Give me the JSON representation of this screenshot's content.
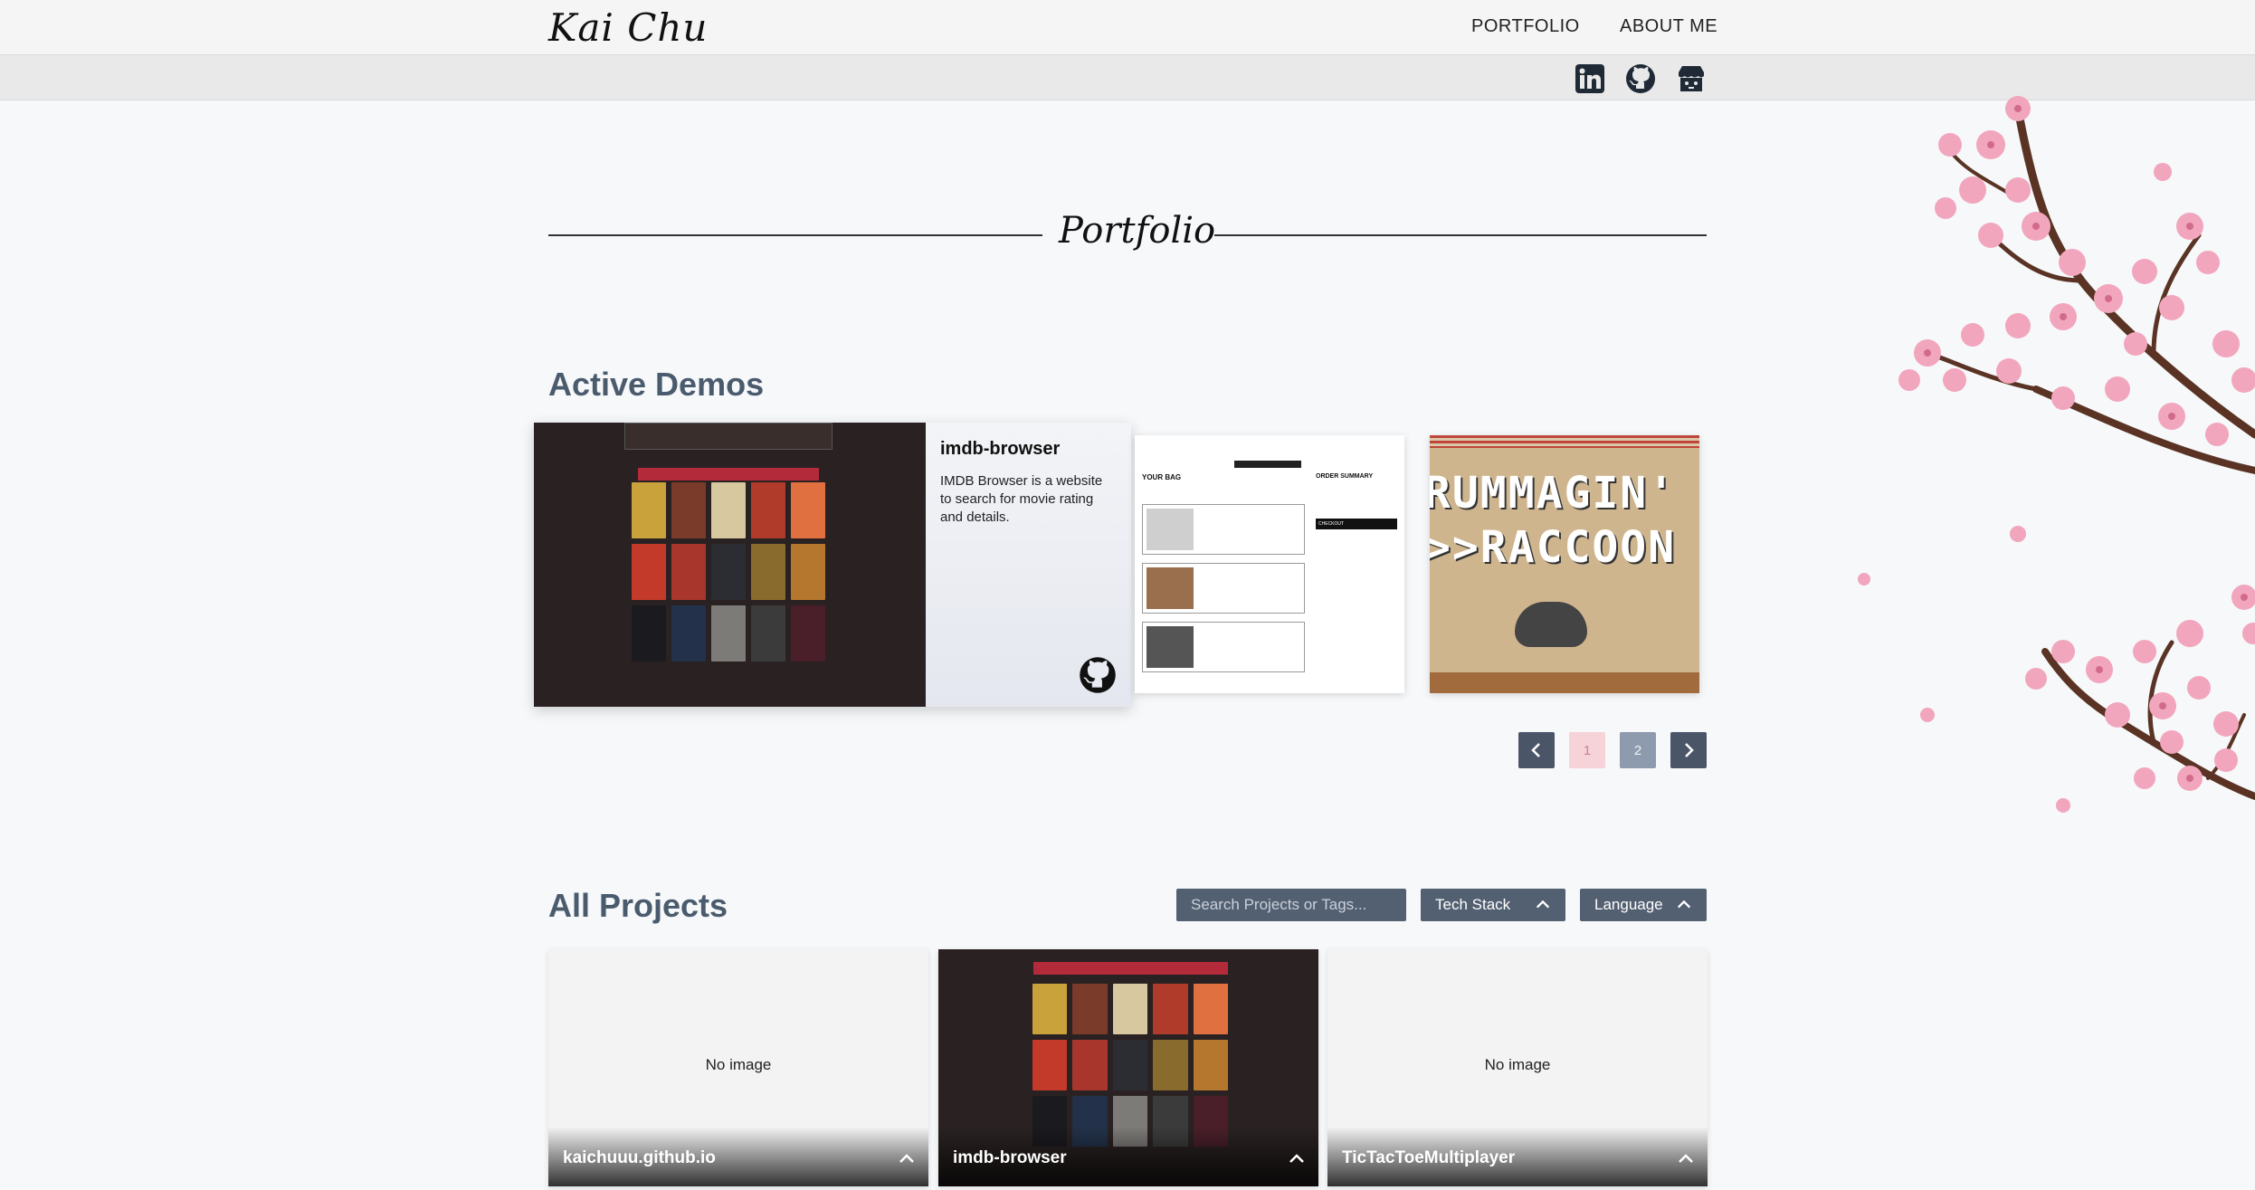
{
  "header": {
    "logo": "Kai Chu",
    "nav": [
      "PORTFOLIO",
      "ABOUT ME"
    ],
    "social": [
      "linkedin-icon",
      "github-icon",
      "store-icon"
    ]
  },
  "portfolio": {
    "title": "Portfolio"
  },
  "active_demos": {
    "heading": "Active Demos",
    "featured": {
      "name": "imdb-browser",
      "description": "IMDB Browser is a website to search for movie rating and details."
    },
    "card2": {
      "bag_title": "YOUR BAG",
      "summary_title": "ORDER SUMMARY",
      "checkout": "CHECKOUT"
    },
    "card3": {
      "line1": "RUMMAGIN'",
      "line2": ">>RACCOON"
    },
    "pagination": {
      "pages": [
        "1",
        "2"
      ],
      "current": "1"
    }
  },
  "all_projects": {
    "heading": "All Projects",
    "search_placeholder": "Search Projects or Tags...",
    "filters": [
      "Tech Stack",
      "Language"
    ],
    "cards": [
      {
        "name": "kaichuuu.github.io",
        "image": "No image"
      },
      {
        "name": "imdb-browser",
        "image": ""
      },
      {
        "name": "TicTacToeMultiplayer",
        "image": "No image"
      }
    ]
  },
  "colors": {
    "accent": "#536072",
    "pink": "#f5d3d8",
    "heading": "#4b5b6e"
  }
}
